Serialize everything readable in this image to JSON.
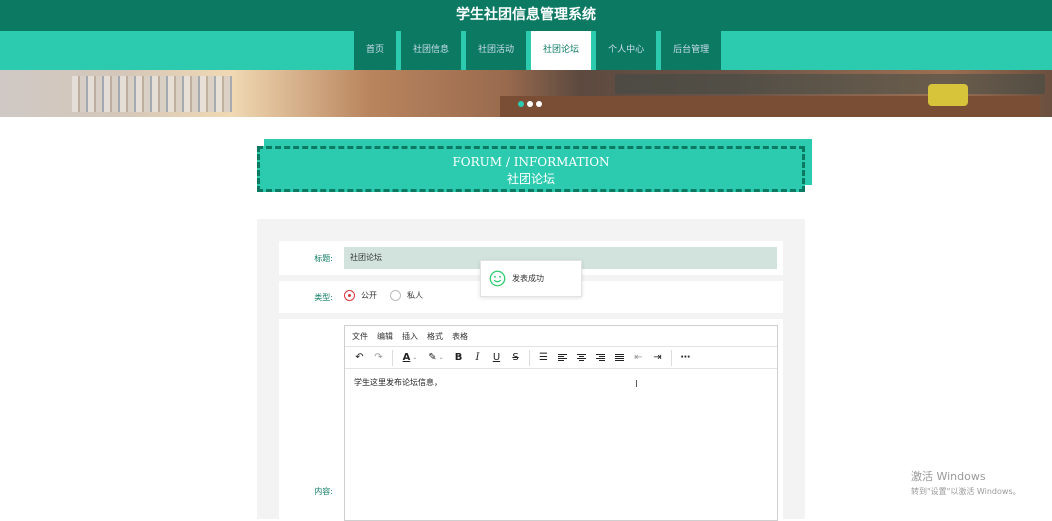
{
  "header": {
    "title": "学生社团信息管理系统"
  },
  "nav": {
    "items": [
      {
        "label": "首页"
      },
      {
        "label": "社团信息"
      },
      {
        "label": "社团活动"
      },
      {
        "label": "社团论坛"
      },
      {
        "label": "个人中心"
      },
      {
        "label": "后台管理"
      }
    ],
    "active_index": 3
  },
  "banner": {
    "slides": 3,
    "active_slide": 0
  },
  "section": {
    "title_en": "FORUM / INFORMATION",
    "title_cn": "社团论坛"
  },
  "form": {
    "title_label": "标题:",
    "title_value": "社团论坛",
    "type_label": "类型:",
    "type_options": [
      "公开",
      "私人"
    ],
    "type_selected": "公开",
    "content_label": "内容:"
  },
  "editor": {
    "menu": [
      "文件",
      "编辑",
      "插入",
      "格式",
      "表格"
    ],
    "toolbar_icons": [
      "undo-icon",
      "redo-icon",
      "text-color-icon",
      "highlight-icon",
      "bold-icon",
      "italic-icon",
      "underline-icon",
      "strikethrough-icon",
      "list-icon",
      "align-left-icon",
      "align-center-icon",
      "align-right-icon",
      "align-justify-icon",
      "outdent-icon",
      "indent-icon",
      "more-icon"
    ],
    "content": "学生这里发布论坛信息，"
  },
  "toast": {
    "message": "发表成功",
    "icon": "smile-icon"
  },
  "watermark": {
    "line1": "激活 Windows",
    "line2": "转到\"设置\"以激活 Windows。"
  },
  "colors": {
    "primary": "#2ccbb0",
    "dark": "#0c7a63",
    "input_bg": "#d2e3de",
    "radio_checked": "#d9363e"
  }
}
